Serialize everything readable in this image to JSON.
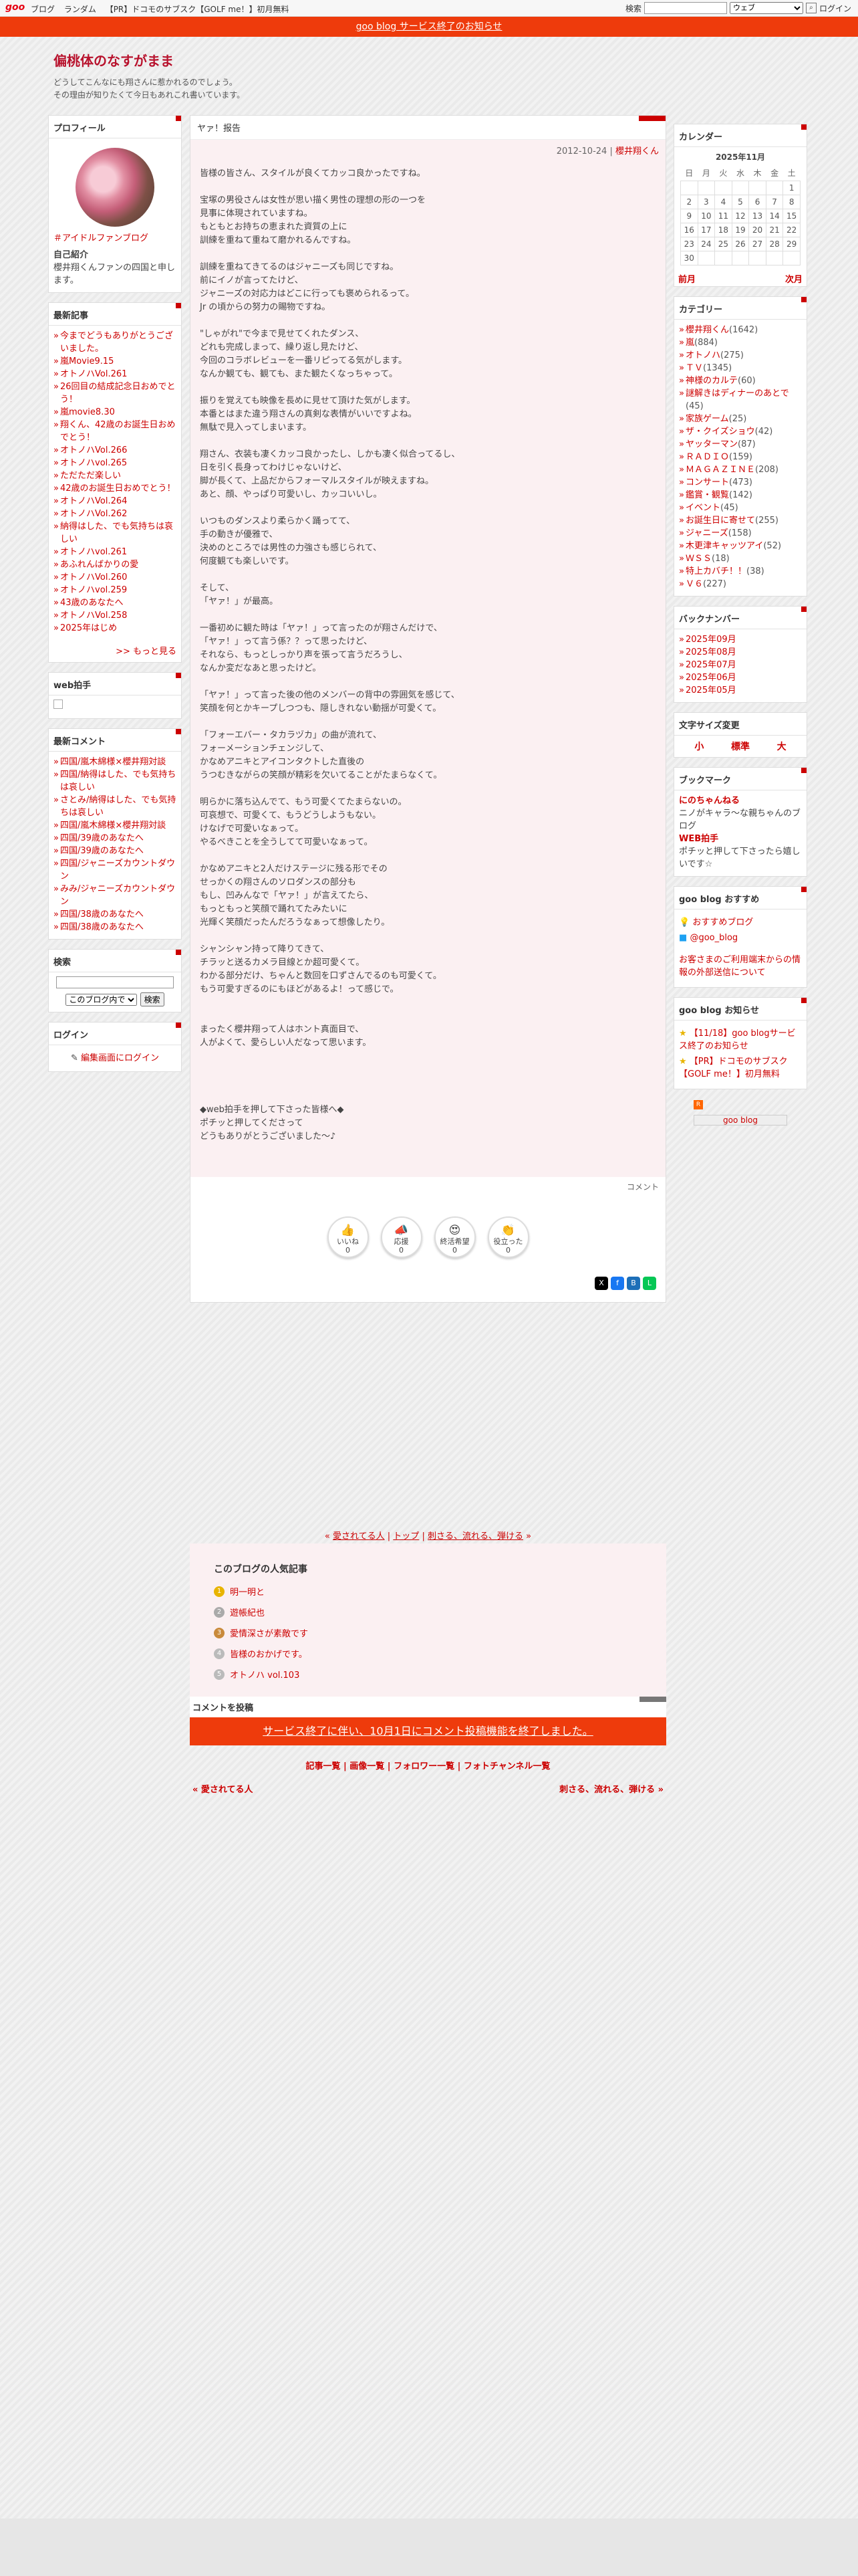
{
  "topbar": {
    "logo": "goo",
    "nav": [
      "ブログ",
      "ランダム",
      "【PR】ドコモのサブスク【GOLF me！】初月無料"
    ],
    "search_label": "検索",
    "search_scope": "ウェブ",
    "login": "ログイン"
  },
  "notice": "goo blog サービス終了のお知らせ",
  "blog": {
    "title": "偏桃体のなすがまま",
    "description": [
      "どうしてこんなにも翔さんに惹かれるのでしょう。",
      "その理由が知りたくて今日もあれこれ書いています。"
    ]
  },
  "profile": {
    "title": "プロフィール",
    "link": "＃アイドルファンブログ",
    "intro_label": "自己紹介",
    "intro": "櫻井翔くんファンの四国と申します。"
  },
  "recent": {
    "title": "最新記事",
    "items": [
      "今までどうもありがとうございました。",
      "嵐Movie9.15",
      "オトノハVol.261",
      "26回目の結成記念日おめでとう！",
      "嵐movie8.30",
      "翔くん、42歳のお誕生日おめでとう！",
      "オトノハVol.266",
      "オトノハvol.265",
      "ただただ楽しい",
      "42歳のお誕生日おめでとう！",
      "オトノハVol.264",
      "オトノハVol.262",
      "納得はした、でも気持ちは哀しい",
      "オトノハvol.261",
      "あふれんばかりの愛",
      "オトノハVol.260",
      "オトノハvol.259",
      "43歳のあなたへ",
      "オトノハVol.258",
      "2025年はじめ"
    ],
    "more": ">> もっと見る"
  },
  "webclap": {
    "title": "web拍手"
  },
  "comments": {
    "title": "最新コメント",
    "items": [
      "四国/嵐木綿様×櫻井翔対談",
      "四国/納得はした、でも気持ちは哀しい",
      "さとみ/納得はした、でも気持ちは哀しい",
      "四国/嵐木綿様×櫻井翔対談",
      "四国/39歳のあなたへ",
      "四国/39歳のあなたへ",
      "四国/ジャニーズカウントダウン",
      "みみ/ジャニーズカウントダウン",
      "四国/38歳のあなたへ",
      "四国/38歳のあなたへ"
    ]
  },
  "search": {
    "title": "検索",
    "scope": "このブログ内で",
    "button": "検索"
  },
  "login": {
    "title": "ログイン",
    "link": "編集画面にログイン"
  },
  "article": {
    "title": "ヤァ！报告",
    "date": "2012-10-24",
    "category": "櫻井翔くん",
    "body": "皆様の皆さん、スタイルが良くてカッコ良かったですね。\n\n宝塚の男役さんは女性が思い描く男性の理想の形の一つを\n見事に体現されていますね。\nもともとお持ちの恵まれた資質の上に\n訓練を重ねて重ねて磨かれるんですね。\n\n訓練を重ねてきてるのはジャニーズも同じですね。\n前にイノが言ってたけど、\nジャニーズの対応力はどこに行っても褒められるって。\nJr の頃からの努力の賜物ですね。\n\n\"しゃがれ\"で今まで見せてくれたダンス、\nどれも完成しまって、繰り返し見たけど、\n今回のコラボレビューを一番リピってる気がします。\nなんか観ても、観ても、また観たくなっちゃって。\n\n振りを覚えても映像を長めに見せて頂けた気がします。\n本番とはまた違う翔さんの真剣な表情がいいですよね。\n無駄で見入ってしまいます。\n\n翔さん、衣装も凄くカッコ良かったし、しかも凄く似合ってるし、\n日を引く長身ってわけじゃないけど、\n脚が長くて、上品だからフォーマルスタイルが映えますね。\nあと、顔、やっぱり可愛いし、カッコいいし。\n\nいつものダンスより柔らかく踊ってて、\n手の動きが優雅で、\n決めのところでは男性の力強さも感じられて、\n何度観ても楽しいです。\n\nそして、\n「ヤァ！」が最高。\n\n一番初めに観た時は「ヤァ！」って言ったのが翔さんだけで、\n「ヤァ！」って言う係？？って思ったけど、\nそれなら、もっとしっかり声を張って言うだろうし、\nなんか変だなあと思ったけど。\n\n「ヤァ！」って言った後の他のメンバーの背中の雰囲気を感じて、\n笑顔を何とかキープしつつも、隠しきれない動揺が可愛くて。\n\n「フォーエバー・タカラヅカ」の曲が流れて、\nフォーメーションチェンジして、\nかなめアニキとアイコンタクトした直後の\nうつむきながらの笑顔が精彩を欠いてることがたまらなくて。\n\n明らかに落ち込んでて、もう可愛くてたまらないの。\n可哀想で、可愛くて、もうどうしようもない。\nけなげで可愛いなぁって。\nやるべきことを全うしてて可愛いなぁって。\n\nかなめアニキと2人だけステージに残る形でその\nせっかくの翔さんのソロダンスの部分も\nもし、凹みんなで「ヤァ！」が言えてたら、\nもっともっと笑顔で踊れてたみたいに\n光輝く笑顔だったんだろうなぁって想像したり。\n\nシャンシャン持って降りてきて、\nチラッと送るカメラ目線とか超可愛くて。\nわかる部分だけ、ちゃんと数回を口ずさんでるのも可愛くて。\nもう可愛すぎるのにもほどがあるよ！って感じで。\n\n\nまったく櫻井翔って人はホント真面目で、\n人がよくて、愛らしい人だなって思います。\n\n\n\n\n◆web拍手を押して下さった皆様へ◆\nポチッと押してくださって\nどうもありがとうございました〜♪",
    "comment_link": "コメント",
    "reactions": [
      {
        "icon": "👍",
        "label": "いいね",
        "count": "0"
      },
      {
        "icon": "📣",
        "label": "応援",
        "count": "0"
      },
      {
        "icon": "😍",
        "label": "終活希望",
        "count": "0"
      },
      {
        "icon": "👏",
        "label": "役立った",
        "count": "0"
      }
    ]
  },
  "pager": {
    "prev": "愛されてる人",
    "top": "トップ",
    "next": "刺さる、流れる、弾ける"
  },
  "popular": {
    "title": "このブログの人気記事",
    "items": [
      "明一明と",
      "遊帳紀也",
      "愛情深さが素敵です",
      "皆様のおかげです。",
      "オトノハ vol.103"
    ]
  },
  "comment_form": {
    "title": "コメントを投稿",
    "notice": "サービス終了に伴い、10月1日にコメント投稿機能を終了しました。"
  },
  "footer_links": [
    "記事一覧",
    "画像一覧",
    "フォロワー一覧",
    "フォトチャンネル一覧"
  ],
  "footer_nav": {
    "prev": "« 愛されてる人",
    "next": "刺さる、流れる、弾ける »"
  },
  "calendar": {
    "title": "カレンダー",
    "month": "2025年11月",
    "weekdays": [
      "日",
      "月",
      "火",
      "水",
      "木",
      "金",
      "土"
    ],
    "weeks": [
      [
        "",
        "",
        "",
        "",
        "",
        "",
        "1"
      ],
      [
        "2",
        "3",
        "4",
        "5",
        "6",
        "7",
        "8"
      ],
      [
        "9",
        "10",
        "11",
        "12",
        "13",
        "14",
        "15"
      ],
      [
        "16",
        "17",
        "18",
        "19",
        "20",
        "21",
        "22"
      ],
      [
        "23",
        "24",
        "25",
        "26",
        "27",
        "28",
        "29"
      ],
      [
        "30",
        "",
        "",
        "",
        "",
        "",
        ""
      ]
    ],
    "prev": "前月",
    "next": "次月"
  },
  "categories": {
    "title": "カテゴリー",
    "items": [
      {
        "name": "櫻井翔くん",
        "count": "(1642)"
      },
      {
        "name": "嵐",
        "count": "(884)"
      },
      {
        "name": "オトノハ",
        "count": "(275)"
      },
      {
        "name": "ＴＶ",
        "count": "(1345)"
      },
      {
        "name": "神様のカルテ",
        "count": "(60)"
      },
      {
        "name": "謎解きはディナーのあとで",
        "count": "(45)"
      },
      {
        "name": "家族ゲーム",
        "count": "(25)"
      },
      {
        "name": "ザ・クイズショウ",
        "count": "(42)"
      },
      {
        "name": "ヤッターマン",
        "count": "(87)"
      },
      {
        "name": "ＲＡＤＩＯ",
        "count": "(159)"
      },
      {
        "name": "ＭＡＧＡＺＩＮＥ",
        "count": "(208)"
      },
      {
        "name": "コンサート",
        "count": "(473)"
      },
      {
        "name": "鑑賞・観覧",
        "count": "(142)"
      },
      {
        "name": "イベント",
        "count": "(45)"
      },
      {
        "name": "お誕生日に寄せて",
        "count": "(255)"
      },
      {
        "name": "ジャニーズ",
        "count": "(158)"
      },
      {
        "name": "木更津キャッツアイ",
        "count": "(52)"
      },
      {
        "name": "ＷＳＳ",
        "count": "(18)"
      },
      {
        "name": "特上カバチ！！",
        "count": "(38)"
      },
      {
        "name": "Ｖ６",
        "count": "(227)"
      }
    ]
  },
  "backnumber": {
    "title": "バックナンバー",
    "items": [
      "2025年09月",
      "2025年08月",
      "2025年07月",
      "2025年06月",
      "2025年05月"
    ]
  },
  "fontsize": {
    "title": "文字サイズ変更",
    "options": [
      "小",
      "標準",
      "大"
    ]
  },
  "bookmark": {
    "title": "ブックマーク",
    "items": [
      {
        "name": "にのちゃんねる",
        "desc": "ニノがキャラ～な親ちゃんのブログ"
      },
      {
        "name": "WEB拍手",
        "desc": "ポチッと押して下さったら嬉しいです☆"
      }
    ]
  },
  "recommend": {
    "title": "goo blog おすすめ",
    "items": [
      "おすすめブログ",
      "@goo_blog"
    ],
    "notice": "お客さまのご利用端末からの情報の外部送信について"
  },
  "news": {
    "title": "goo blog お知らせ",
    "items": [
      "【11/18】goo blogサービス終了のお知らせ",
      "【PR】ドコモのサブスク【GOLF me！】初月無料"
    ]
  },
  "footer_logo": "goo blog"
}
